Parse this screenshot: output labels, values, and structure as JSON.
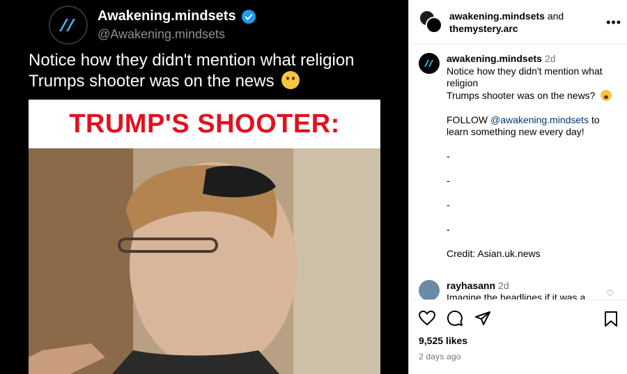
{
  "tweet": {
    "name": "Awakening.mindsets",
    "handle": "@Awakening.mindsets",
    "text": "Notice how they didn't mention what religion Trumps shooter was on the news",
    "headline": "TRUMP'S SHOOTER:"
  },
  "panel": {
    "author": "awakening.mindsets",
    "and": "and",
    "coauthor": "themystery.arc",
    "more_icon": "more-horizontal-icon",
    "caption": {
      "username": "awakening.mindsets",
      "time": "2d",
      "line1": "Notice how they didn't mention what religion",
      "line2": "Trumps shooter was on the news?",
      "follow_prefix": "FOLLOW",
      "follow_link": "@awakening.mindsets",
      "follow_suffix": "to learn something new every day!",
      "dashes": [
        "-",
        "-",
        "-",
        "-"
      ],
      "credit": "Credit: Asian.uk.news"
    },
    "comment": {
      "username": "rayhasann",
      "time": "2d",
      "text": "Imagine the headlines if it was a"
    },
    "likes": "9,525 likes",
    "date": "2 days ago"
  },
  "colors": {
    "verified": "#1d9bf0",
    "headline_red": "#e3101f",
    "link": "#00376b",
    "muted": "#737373"
  }
}
